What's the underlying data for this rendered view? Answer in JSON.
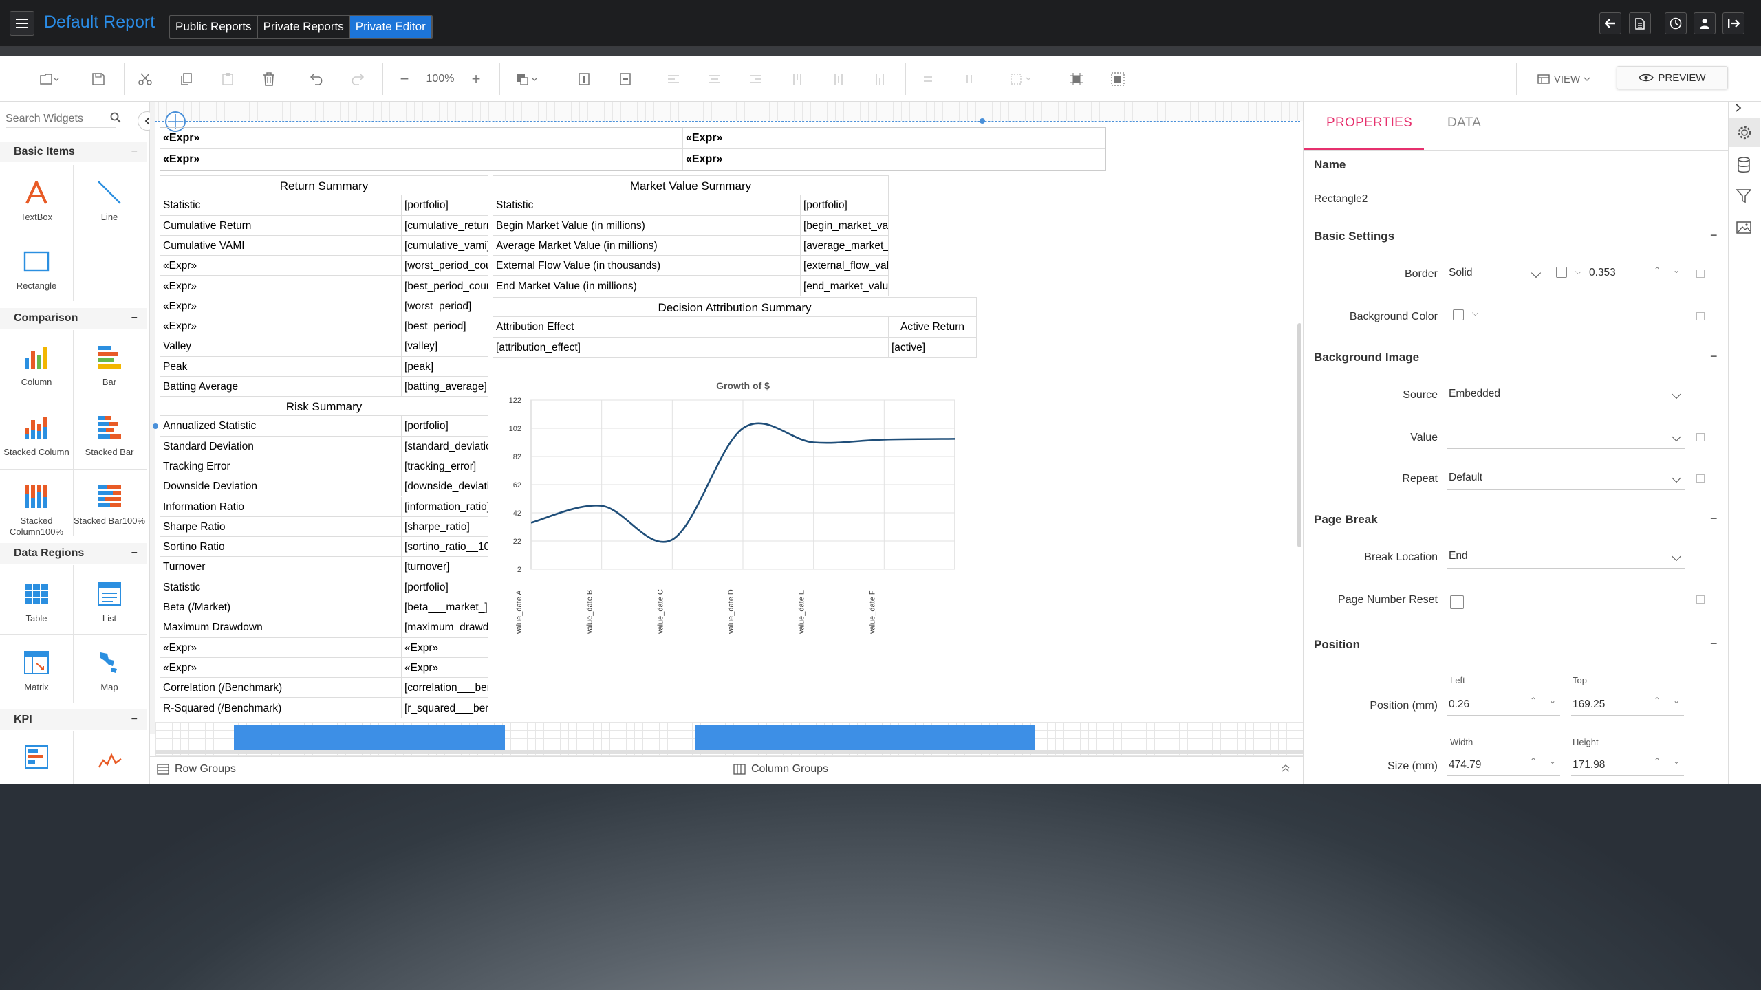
{
  "header": {
    "app_title": "Default Report",
    "crumbs": [
      "Public Reports",
      "Private Reports",
      "Private Editor"
    ]
  },
  "toolbar": {
    "zoom": "100%",
    "view_label": "VIEW",
    "preview_label": "PREVIEW"
  },
  "left_panel": {
    "search_placeholder": "Search Widgets",
    "sections": {
      "basic": "Basic Items",
      "comparison": "Comparison",
      "data_regions": "Data Regions",
      "kpi": "KPI"
    },
    "widgets": {
      "textbox": "TextBox",
      "line": "Line",
      "rectangle": "Rectangle",
      "column": "Column",
      "bar": "Bar",
      "stacked_column": "Stacked Column",
      "stacked_bar": "Stacked Bar",
      "stacked_column100": "Stacked Column100%",
      "stacked_bar100": "Stacked Bar100%",
      "table": "Table",
      "list": "List",
      "matrix": "Matrix",
      "map": "Map"
    }
  },
  "report": {
    "expr": "«Expr»",
    "return_summary": {
      "title": "Return Summary",
      "rows": [
        [
          "Statistic",
          "[portfolio]"
        ],
        [
          "Cumulative Return",
          "[cumulative_return"
        ],
        [
          "Cumulative VAMI",
          "[cumulative_vami]"
        ],
        [
          "«Expr»",
          "[worst_period_cou"
        ],
        [
          "«Expr»",
          "[best_period_coun"
        ],
        [
          "«Expr»",
          "[worst_period]"
        ],
        [
          "«Expr»",
          "[best_period]"
        ],
        [
          "Valley",
          "[valley]"
        ],
        [
          "Peak",
          "[peak]"
        ],
        [
          "Batting Average",
          "[batting_average]"
        ]
      ]
    },
    "risk_summary": {
      "title": "Risk Summary",
      "rows": [
        [
          "Annualized Statistic",
          "[portfolio]"
        ],
        [
          "Standard Deviation",
          "[standard_deviatic"
        ],
        [
          "Tracking Error",
          "[tracking_error]"
        ],
        [
          "Downside Deviation",
          "[downside_deviati"
        ],
        [
          "Information Ratio",
          "[information_ratio]"
        ],
        [
          "Sharpe Ratio",
          "[sharpe_ratio]"
        ],
        [
          "Sortino Ratio",
          "[sortino_ratio__10"
        ],
        [
          "Turnover",
          "[turnover]"
        ],
        [
          "Statistic",
          "[portfolio]"
        ],
        [
          "Beta (/Market)",
          "[beta___market_]"
        ],
        [
          "Maximum Drawdown",
          "[maximum_drawd"
        ],
        [
          "«Expr»",
          "«Expr»"
        ],
        [
          "«Expr»",
          "«Expr»"
        ],
        [
          "Correlation (/Benchmark)",
          "[correlation___ber"
        ],
        [
          "R-Squared (/Benchmark)",
          "[r_squared___ber"
        ]
      ]
    },
    "market_value_summary": {
      "title": "Market Value Summary",
      "rows": [
        [
          "Statistic",
          "[portfolio]"
        ],
        [
          "Begin Market Value (in millions)",
          "[begin_market_val"
        ],
        [
          "Average Market Value (in millions)",
          "[average_market_"
        ],
        [
          "External Flow Value (in thousands)",
          "[external_flow_val"
        ],
        [
          "End Market Value (in millions)",
          "[end_market_value"
        ]
      ]
    },
    "decision_attribution": {
      "title": "Decision Attribution Summary",
      "rows": [
        [
          "Attribution Effect",
          "Active Return"
        ],
        [
          "[attribution_effect]",
          "[active]"
        ]
      ]
    }
  },
  "chart_data": {
    "type": "line",
    "title": "Growth of $",
    "categories": [
      "value_date A",
      "value_date B",
      "value_date C",
      "value_date D",
      "value_date E",
      "value_date F"
    ],
    "series": [
      {
        "values": [
          35,
          47,
          23,
          102,
          92,
          94
        ]
      }
    ],
    "yticks": [
      2,
      22,
      42,
      62,
      82,
      102,
      122
    ],
    "ylim": [
      2,
      122
    ],
    "grid": true,
    "color": "#1f4e79"
  },
  "group_bar": {
    "row_groups": "Row Groups",
    "column_groups": "Column Groups"
  },
  "properties": {
    "tabs": [
      "PROPERTIES",
      "DATA"
    ],
    "name_label": "Name",
    "name_value": "Rectangle2",
    "basic_settings": "Basic Settings",
    "border_label": "Border",
    "border_style": "Solid",
    "border_width": "0.353",
    "bg_color_label": "Background Color",
    "bg_image": "Background Image",
    "source_label": "Source",
    "source_value": "Embedded",
    "value_label": "Value",
    "repeat_label": "Repeat",
    "repeat_value": "Default",
    "page_break": "Page Break",
    "break_location_label": "Break Location",
    "break_location_value": "End",
    "page_number_reset_label": "Page Number Reset",
    "position": "Position",
    "left_label": "Left",
    "top_label": "Top",
    "position_label": "Position (mm)",
    "left_value": "0.26",
    "top_value": "169.25",
    "width_label": "Width",
    "height_label": "Height",
    "size_label": "Size (mm)",
    "width_value": "474.79",
    "height_value": "171.98",
    "accent": "#e6306d"
  }
}
